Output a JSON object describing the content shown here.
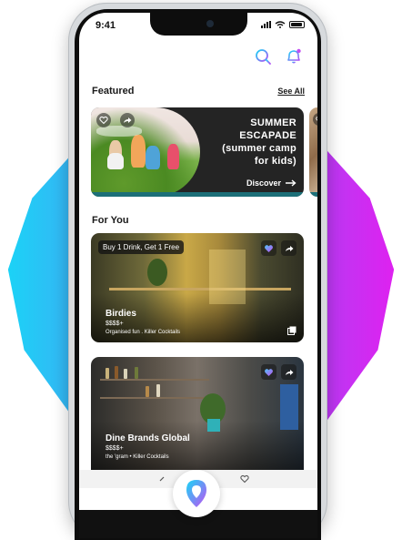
{
  "status": {
    "time": "9:41"
  },
  "featured": {
    "heading": "Featured",
    "see_all": "See All",
    "card": {
      "title_lines": [
        "SUMMER",
        "ESCAPADE",
        "(summer camp",
        "for kids)"
      ],
      "cta": "Discover"
    }
  },
  "for_you": {
    "heading": "For You",
    "venues": [
      {
        "promo": "Buy 1 Drink, Get 1 Free",
        "name": "Birdies",
        "price": "$$$$+",
        "tags": "Organised fun . Killer Cocktails"
      },
      {
        "name": "Dine Brands Global",
        "price": "$$$$+",
        "tags": "the 'gram • Killer Cocktails"
      }
    ]
  },
  "icons": {
    "search": "search-icon",
    "notifications": "bell-icon",
    "favorite": "heart-icon",
    "share": "share-arrow-icon",
    "map_pin": "map-pin-icon",
    "gallery": "gallery-icon"
  },
  "colors": {
    "accent_gradient_start": "#18d6f6",
    "accent_gradient_end": "#e21ff0",
    "card_dark": "#242424",
    "teal": "#1c6f78"
  }
}
